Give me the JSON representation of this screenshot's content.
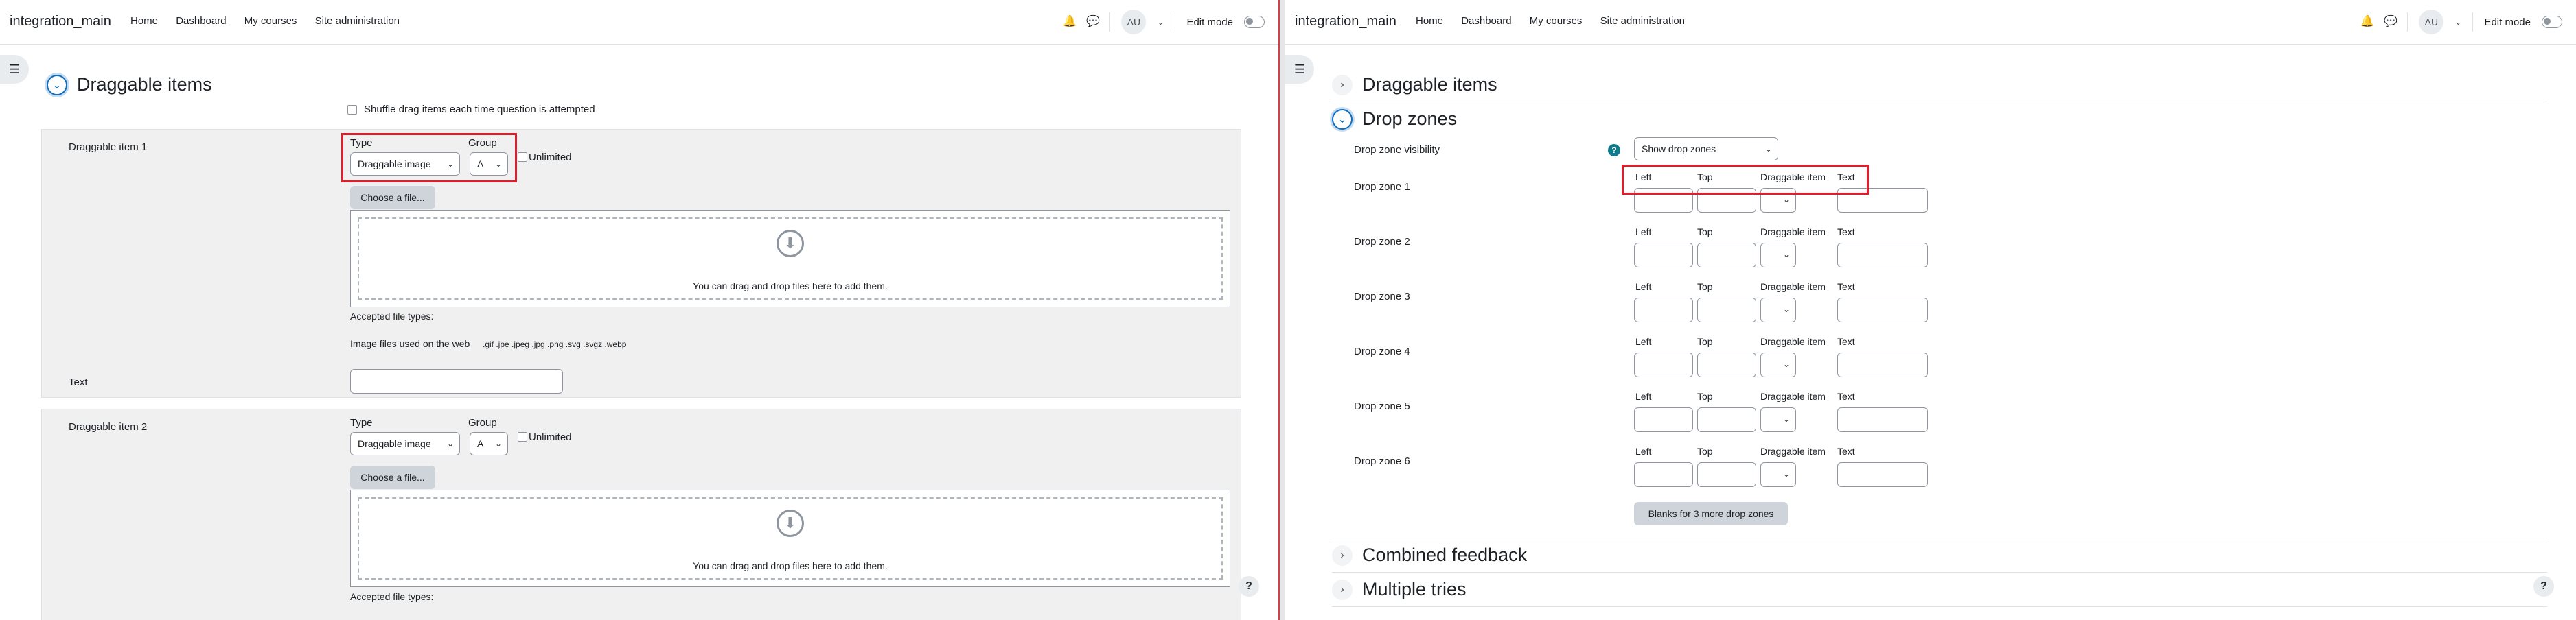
{
  "navbar": {
    "site_name": "integration_main",
    "links": [
      "Home",
      "Dashboard",
      "My courses",
      "Site administration"
    ],
    "avatar_initials": "AU",
    "edit_mode_label": "Edit mode"
  },
  "left": {
    "section_title": "Draggable items",
    "shuffle_label": "Shuffle drag items each time question is attempted",
    "item1": {
      "label": "Draggable item 1",
      "type_label": "Type",
      "type_value": "Draggable image",
      "group_label": "Group",
      "group_value": "A",
      "unlimited_label": "Unlimited",
      "choose_file": "Choose a file...",
      "drop_text": "You can drag and drop files here to add them.",
      "accepted_label": "Accepted file types:",
      "image_types": "Image files used on the web",
      "extensions": ".gif .jpe .jpeg .jpg .png .svg .svgz .webp",
      "text_label": "Text"
    },
    "item2": {
      "label": "Draggable item 2",
      "type_label": "Type",
      "type_value": "Draggable image",
      "group_label": "Group",
      "group_value": "A",
      "unlimited_label": "Unlimited",
      "choose_file": "Choose a file...",
      "drop_text": "You can drag and drop files here to add them.",
      "accepted_label": "Accepted file types:"
    }
  },
  "right": {
    "sections": {
      "draggable_items": "Draggable items",
      "drop_zones": "Drop zones",
      "combined_feedback": "Combined feedback",
      "multiple_tries": "Multiple tries"
    },
    "visibility_label": "Drop zone visibility",
    "visibility_value": "Show drop zones",
    "col_left": "Left",
    "col_top": "Top",
    "col_item": "Draggable item",
    "col_text": "Text",
    "zones": [
      "Drop zone 1",
      "Drop zone 2",
      "Drop zone 3",
      "Drop zone 4",
      "Drop zone 5",
      "Drop zone 6"
    ],
    "blanks_button": "Blanks for 3 more drop zones"
  },
  "colors": {
    "primary": "#0f6cbf",
    "highlight": "#e01e2b",
    "help": "#0f7a8a"
  }
}
